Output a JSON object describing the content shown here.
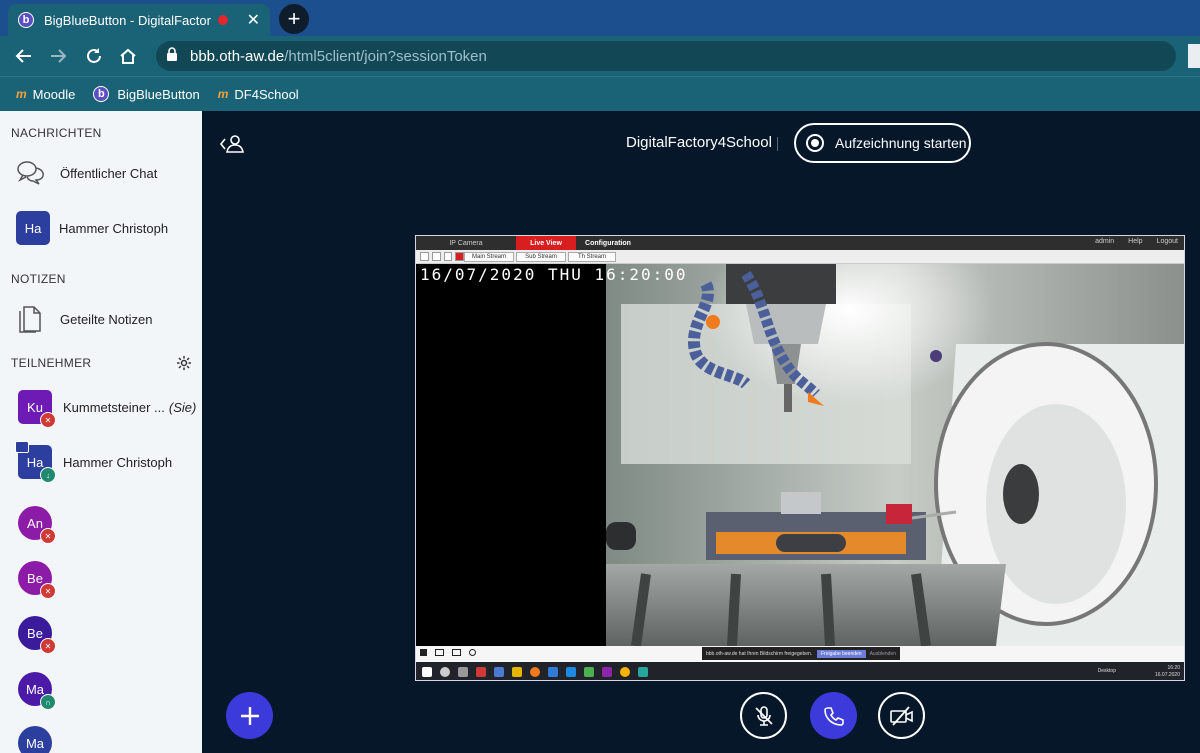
{
  "browser": {
    "tab_title": "BigBlueButton - DigitalFactor",
    "tab_favicon": "b",
    "new_tab": "+",
    "url_host": "bbb.oth-aw.de",
    "url_path": "/html5client/join?sessionToken",
    "bookmarks": [
      {
        "label": "Moodle",
        "icon": "moodle-icon"
      },
      {
        "label": "BigBlueButton",
        "icon": "bbb-icon"
      },
      {
        "label": "DF4School",
        "icon": "moodle-icon"
      }
    ]
  },
  "sidebar": {
    "messages_title": "NACHRICHTEN",
    "public_chat": "Öffentlicher Chat",
    "private_chat": {
      "initials": "Ha",
      "name": "Hammer Christoph"
    },
    "notes_title": "NOTIZEN",
    "shared_notes": "Geteilte Notizen",
    "participants_title": "TEILNEHMER",
    "participants": [
      {
        "initials": "Ku",
        "name": "Kummetsteiner ...",
        "suffix": "(Sie)",
        "color": "#6E1BB5",
        "shape": "square",
        "status": "muted"
      },
      {
        "initials": "Ha",
        "name": "Hammer Christoph",
        "suffix": "",
        "color": "#2C3F9E",
        "shape": "square",
        "status": "listen",
        "presenter": true
      },
      {
        "initials": "An",
        "name": "",
        "color": "#8C1BA8",
        "shape": "circle",
        "status": "muted"
      },
      {
        "initials": "Be",
        "name": "",
        "color": "#8C1BA8",
        "shape": "circle",
        "status": "muted"
      },
      {
        "initials": "Be",
        "name": "",
        "color": "#3A1B9C",
        "shape": "circle",
        "status": "muted"
      },
      {
        "initials": "Ma",
        "name": "",
        "color": "#4B1BA8",
        "shape": "circle",
        "status": "listen"
      },
      {
        "initials": "Ma",
        "name": "",
        "color": "#2C3F9E",
        "shape": "circle",
        "status": ""
      }
    ]
  },
  "main": {
    "meeting_title": "DigitalFactory4School",
    "record_button": "Aufzeichnung starten"
  },
  "screenshare": {
    "tabs": [
      "IP Camera",
      "Live View",
      "Configuration"
    ],
    "right_links": [
      "admin",
      "Help",
      "Logout"
    ],
    "stream_buttons": [
      "Main Stream",
      "Sub Stream",
      "Th Stream"
    ],
    "timestamp": "16/07/2020 THU 16:20:00",
    "share_notice": "bbb.oth-aw.de hat Ihren Bildschirm freigegeben.",
    "share_stop": "Freigabe beenden",
    "share_hide": "Ausblenden",
    "tray_text": "Desktop",
    "clock_time": "16:20",
    "clock_date": "16.07.2020"
  },
  "colors": {
    "accent": "#3D3ADB",
    "chrome": "#1A6276",
    "main_bg": "#06172A",
    "muted": "#D03A36",
    "listen": "#1F8A70"
  }
}
